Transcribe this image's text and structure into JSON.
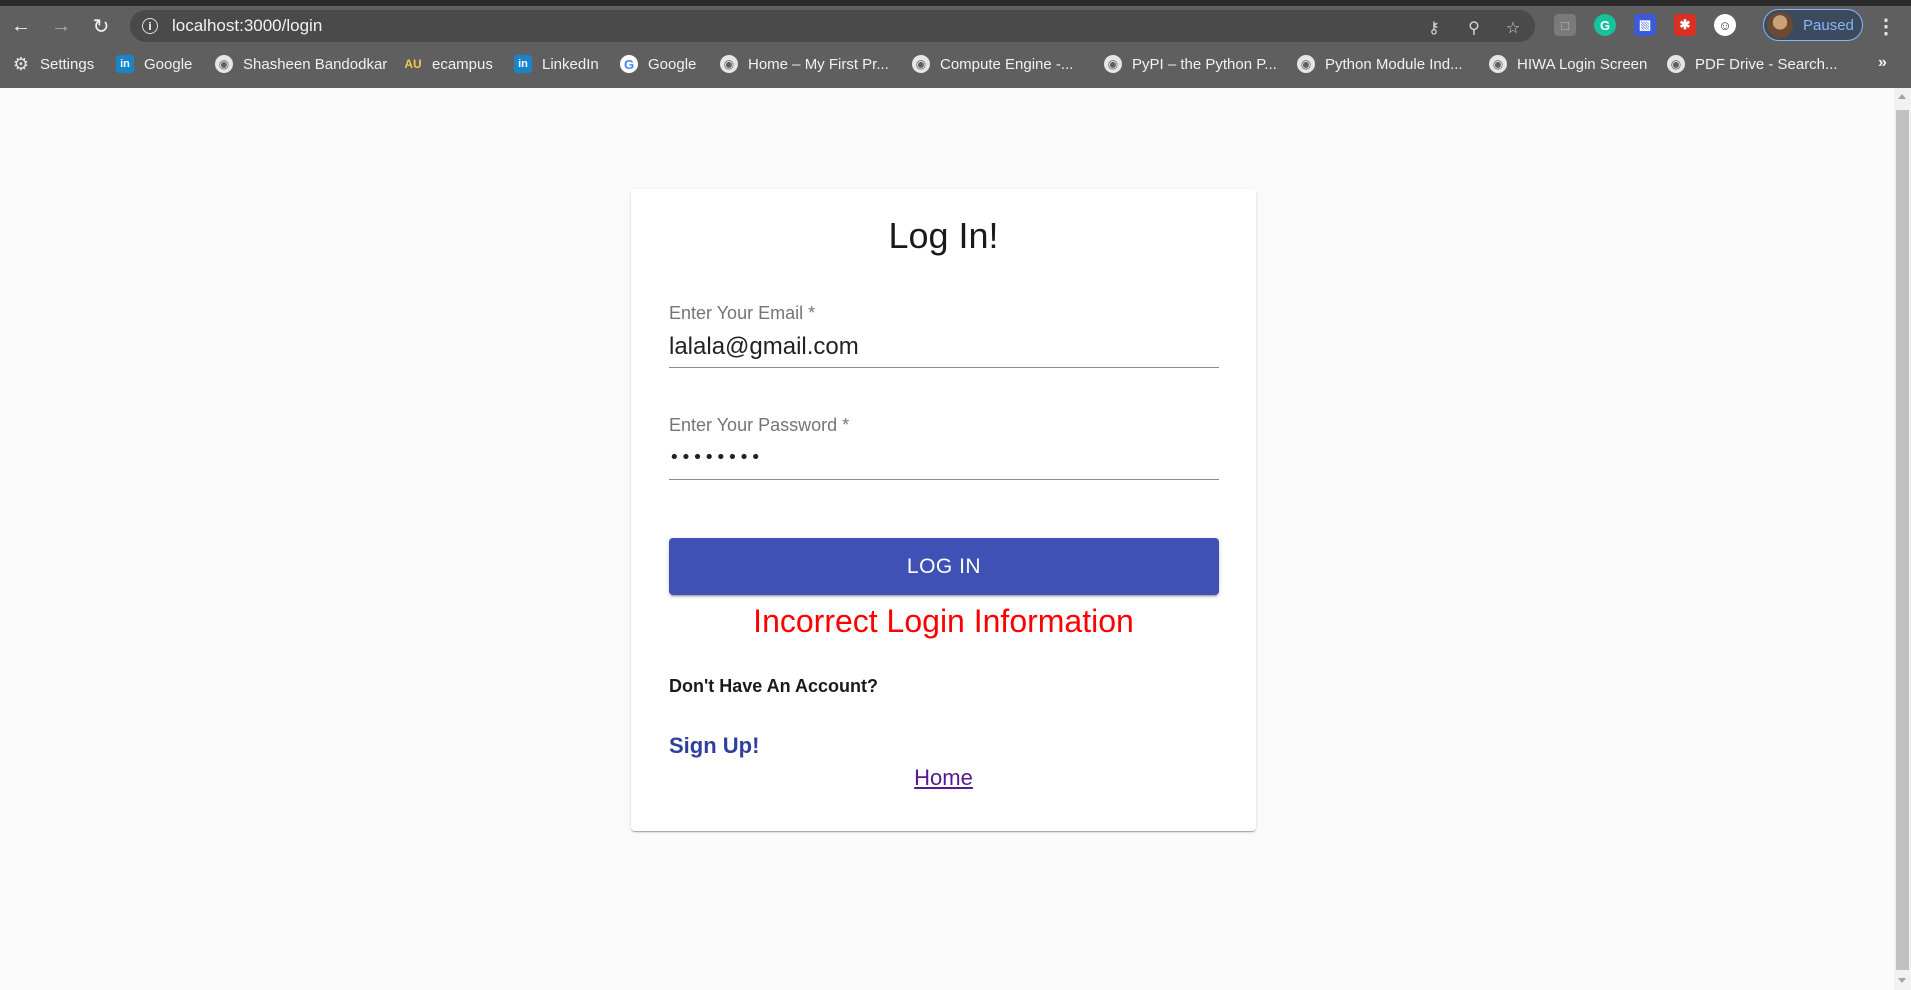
{
  "browser": {
    "url": "localhost:3000/login",
    "profile_label": "Paused",
    "bookmarks": [
      {
        "label": "Settings",
        "icon": "gear-icon"
      },
      {
        "label": "Google",
        "icon": "linkedin-icon"
      },
      {
        "label": "Shasheen Bandodkar",
        "icon": "globe-icon"
      },
      {
        "label": "ecampus",
        "icon": "au-icon"
      },
      {
        "label": "LinkedIn",
        "icon": "linkedin-icon"
      },
      {
        "label": "Google",
        "icon": "google-icon"
      },
      {
        "label": "Home – My First Pr...",
        "icon": "globe-icon"
      },
      {
        "label": "Compute Engine -...",
        "icon": "globe-icon"
      },
      {
        "label": "PyPI – the Python P...",
        "icon": "globe-icon"
      },
      {
        "label": "Python Module Ind...",
        "icon": "globe-icon"
      },
      {
        "label": "HIWA Login Screen",
        "icon": "globe-icon"
      },
      {
        "label": "PDF Drive - Search...",
        "icon": "globe-icon"
      }
    ],
    "bookmarks_overflow": "»"
  },
  "login": {
    "title": "Log In!",
    "email_label": "Enter Your Email *",
    "email_value": "lalala@gmail.com",
    "password_label": "Enter Your Password *",
    "password_masked": "••••••••",
    "submit_label": "LOG IN",
    "error_message": "Incorrect Login Information",
    "no_account_text": "Don't Have An Account?",
    "signup_label": "Sign Up!",
    "home_label": "Home"
  },
  "colors": {
    "primary": "#3f51b5",
    "error": "#ff0000",
    "signup_link": "#303f9f",
    "visited_link": "#551a8b"
  }
}
